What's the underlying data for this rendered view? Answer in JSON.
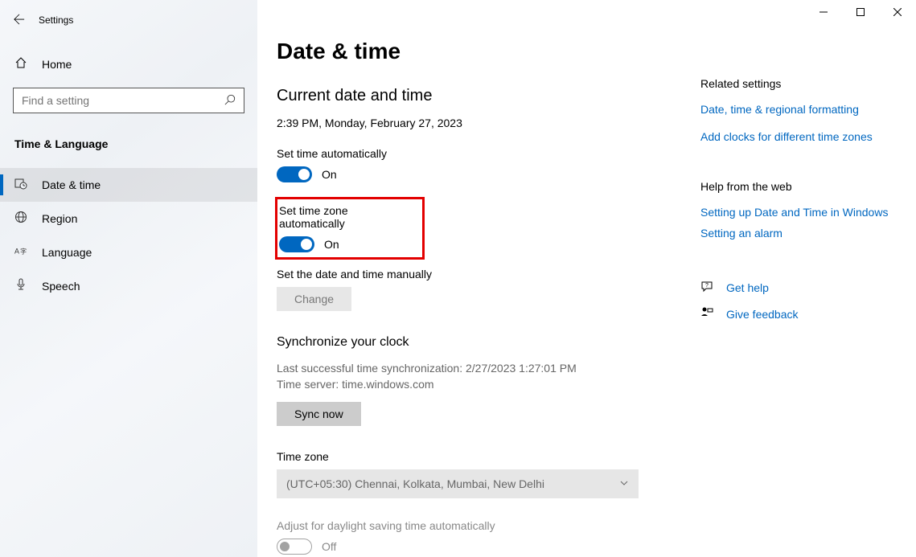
{
  "titlebar": {
    "label": "Settings"
  },
  "sidebar": {
    "home": "Home",
    "search_placeholder": "Find a setting",
    "category": "Time & Language",
    "items": [
      {
        "label": "Date & time"
      },
      {
        "label": "Region"
      },
      {
        "label": "Language"
      },
      {
        "label": "Speech"
      }
    ]
  },
  "page": {
    "title": "Date & time",
    "current_header": "Current date and time",
    "current_value": "2:39 PM, Monday, February 27, 2023",
    "set_time_auto": {
      "label": "Set time automatically",
      "state": "On"
    },
    "set_tz_auto": {
      "label": "Set time zone automatically",
      "state": "On"
    },
    "manual": {
      "label": "Set the date and time manually",
      "button": "Change"
    },
    "sync": {
      "header": "Synchronize your clock",
      "last": "Last successful time synchronization: 2/27/2023 1:27:01 PM",
      "server": "Time server: time.windows.com",
      "button": "Sync now"
    },
    "timezone": {
      "label": "Time zone",
      "value": "(UTC+05:30) Chennai, Kolkata, Mumbai, New Delhi"
    },
    "daylight": {
      "label": "Adjust for daylight saving time automatically",
      "state": "Off"
    }
  },
  "rail": {
    "related_header": "Related settings",
    "related_links": [
      "Date, time & regional formatting",
      "Add clocks for different time zones"
    ],
    "help_header": "Help from the web",
    "help_links": [
      "Setting up Date and Time in Windows",
      "Setting an alarm"
    ],
    "get_help": "Get help",
    "give_feedback": "Give feedback"
  }
}
